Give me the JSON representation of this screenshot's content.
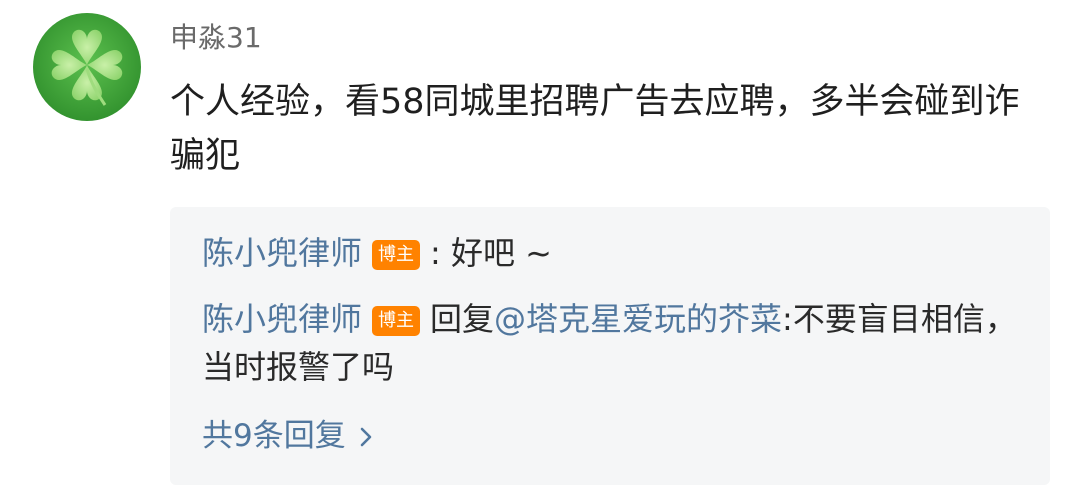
{
  "comment": {
    "username": "申淼31",
    "text": "个人经验，看58同城里招聘广告去应聘，多半会碰到诈骗犯"
  },
  "replies": [
    {
      "author": "陈小兜律师",
      "badge": "博主",
      "separator": ": ",
      "text": "好吧 ~"
    },
    {
      "author": "陈小兜律师",
      "badge": "博主",
      "prefix": "回复",
      "mention": "@塔克星爱玩的芥菜",
      "text": ":不要盲目相信，当时报警了吗"
    }
  ],
  "more_replies": {
    "label": "共9条回复",
    "icon": "chevron-right-icon"
  },
  "colors": {
    "link": "#51779e",
    "badge": "#ff8200",
    "reply_bg": "#f5f6f7",
    "avatar": "#3fa83a"
  }
}
